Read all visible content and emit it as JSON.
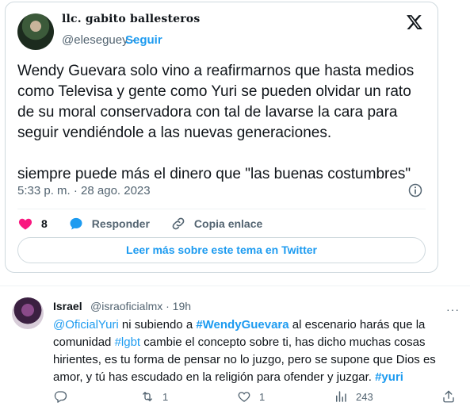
{
  "tweet": {
    "author_name": "llc. gabito ballesteros",
    "handle": "@eleseguey",
    "separator": "·",
    "follow_label": "Seguir",
    "paragraph1": "Wendy Guevara solo vino a reafirmarnos que hasta medios como Televisa y gente como Yuri se pueden olvidar un rato de su moral conservadora con tal de lavarse la cara para seguir vendiéndole a las nuevas generaciones.",
    "paragraph2": "siempre puede más el dinero que \"las buenas costumbres\"",
    "timestamp": "5:33 p. m. · 28 ago. 2023",
    "likes": "8",
    "reply_label": "Responder",
    "copy_label": "Copia enlace",
    "read_more_label": "Leer más sobre este tema en Twitter"
  },
  "reply": {
    "author_name": "Israel",
    "meta": "@israoficialmx · 19h",
    "more": "···",
    "mention": "@OficialYuri",
    "text1": " ni subiendo a ",
    "tag1": "#WendyGuevara",
    "text2": " al escenario harás que la comunidad ",
    "tag2": "#lgbt",
    "text3": " cambie el concepto sobre ti, has dicho muchas cosas hirientes, es tu forma de pensar no lo juzgo, pero se supone que Dios es amor, y tú has escudado en la religión para ofender y juzgar. ",
    "tag3": "#yuri",
    "retweets": "1",
    "likes": "1",
    "views": "243"
  },
  "colors": {
    "accent": "#1d9bf0",
    "like": "#f91880",
    "muted": "#536471"
  },
  "icons": [
    "x-logo-icon",
    "info-icon",
    "heart-icon",
    "reply-icon",
    "link-icon",
    "comment-icon",
    "retweet-icon",
    "like-icon",
    "views-icon",
    "share-icon"
  ]
}
